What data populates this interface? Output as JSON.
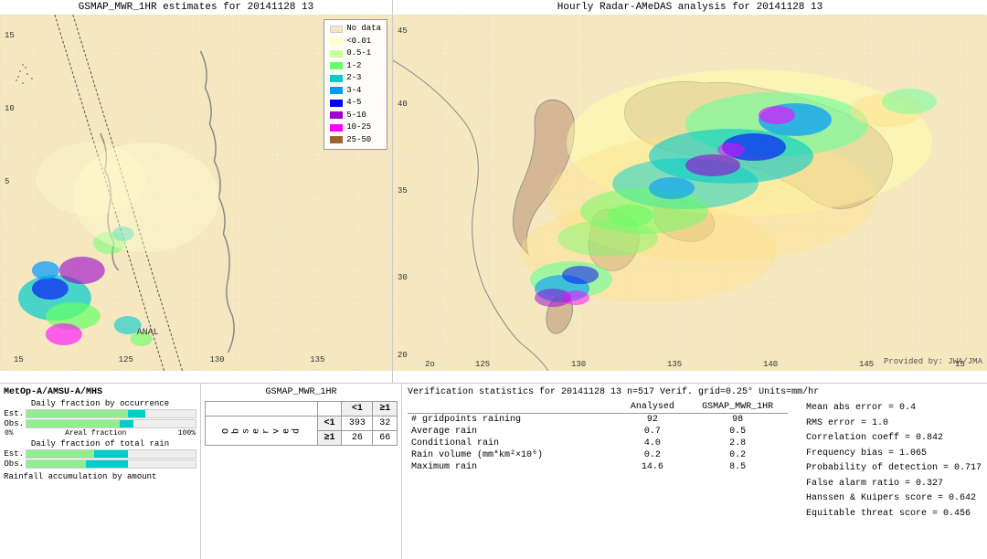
{
  "left_panel": {
    "title": "GSMAP_MWR_1HR estimates for 20141128 13"
  },
  "right_panel": {
    "title": "Hourly Radar-AMeDAS analysis for 20141128 13",
    "jwa_label": "Provided by: JWA/JMA"
  },
  "legend": {
    "items": [
      {
        "label": "No data",
        "color": "#f5e8c0"
      },
      {
        "label": "<0.01",
        "color": "#ffffcc"
      },
      {
        "label": "0.5-1",
        "color": "#ccff99"
      },
      {
        "label": "1-2",
        "color": "#66ff66"
      },
      {
        "label": "2-3",
        "color": "#00cccc"
      },
      {
        "label": "3-4",
        "color": "#0099ff"
      },
      {
        "label": "4-5",
        "color": "#0000ff"
      },
      {
        "label": "5-10",
        "color": "#9900cc"
      },
      {
        "label": "10-25",
        "color": "#ff00ff"
      },
      {
        "label": "25-50",
        "color": "#996633"
      }
    ]
  },
  "bottom_left": {
    "satellite_label": "MetOp-A/AMSU-A/MHS",
    "occurrence_title": "Daily fraction by occurrence",
    "total_rain_title": "Daily fraction of total rain",
    "axis_labels": [
      "0%",
      "Areal fraction",
      "100%"
    ],
    "est_label": "Est.",
    "obs_label": "Obs.",
    "rainfall_label": "Rainfall accumulation by amount"
  },
  "contingency": {
    "title": "GSMAP_MWR_1HR",
    "col_headers": [
      "<1",
      "≥1"
    ],
    "row_header": "O\nb\ns\ne\nr\nv\ne\nd",
    "row_labels": [
      "<1",
      "≥1"
    ],
    "cells": [
      [
        "393",
        "32"
      ],
      [
        "26",
        "66"
      ]
    ]
  },
  "verification": {
    "title": "Verification statistics for 20141128 13  n=517  Verif. grid=0.25°  Units=mm/hr",
    "col_headers": [
      "",
      "Analysed",
      "GSMAP_MWR_1HR"
    ],
    "divider": "--------",
    "rows": [
      {
        "label": "# gridpoints raining",
        "analysed": "92",
        "gsmap": "98"
      },
      {
        "label": "Average rain",
        "analysed": "0.7",
        "gsmap": "0.5"
      },
      {
        "label": "Conditional rain",
        "analysed": "4.0",
        "gsmap": "2.8"
      },
      {
        "label": "Rain volume (mm*km²×10⁶)",
        "analysed": "0.2",
        "gsmap": "0.2"
      },
      {
        "label": "Maximum rain",
        "analysed": "14.6",
        "gsmap": "8.5"
      }
    ],
    "stats": [
      "Mean abs error = 0.4",
      "RMS error = 1.0",
      "Correlation coeff = 0.842",
      "Frequency bias = 1.065",
      "Probability of detection = 0.717",
      "False alarm ratio = 0.327",
      "Hanssen & Kuipers score = 0.642",
      "Equitable threat score = 0.456"
    ]
  }
}
